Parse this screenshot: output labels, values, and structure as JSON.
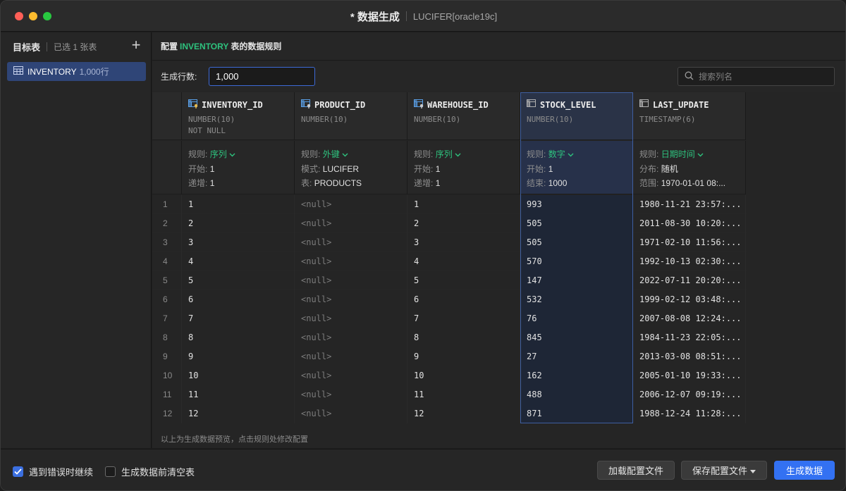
{
  "window": {
    "title": "* 数据生成",
    "connection": "LUCIFER[oracle19c]"
  },
  "sidebar": {
    "title": "目标表",
    "selected_count": "已选 1 张表",
    "add_label": "+",
    "items": [
      {
        "name": "INVENTORY",
        "rows": "1,000行"
      }
    ]
  },
  "config": {
    "prefix": "配置",
    "table": "INVENTORY",
    "suffix": "表的数据规则",
    "rows_label": "生成行数:",
    "rows_value": "1,000",
    "search_placeholder": "搜索列名"
  },
  "columns": [
    {
      "name": "INVENTORY_ID",
      "type": "NUMBER(10)",
      "constraint": "NOT NULL",
      "icon": "primary-key-column-icon",
      "rule": [
        {
          "k": "规则:",
          "v": "序列",
          "dropdown": true
        },
        {
          "k": "开始:",
          "v": "1"
        },
        {
          "k": "递增:",
          "v": "1"
        }
      ]
    },
    {
      "name": "PRODUCT_ID",
      "type": "NUMBER(10)",
      "constraint": "",
      "icon": "foreign-key-column-icon",
      "rule": [
        {
          "k": "规则:",
          "v": "外键",
          "dropdown": true
        },
        {
          "k": "模式:",
          "v": "LUCIFER"
        },
        {
          "k": "表:",
          "v": "PRODUCTS"
        }
      ]
    },
    {
      "name": "WAREHOUSE_ID",
      "type": "NUMBER(10)",
      "constraint": "",
      "icon": "foreign-key-column-icon",
      "rule": [
        {
          "k": "规则:",
          "v": "序列",
          "dropdown": true
        },
        {
          "k": "开始:",
          "v": "1"
        },
        {
          "k": "递增:",
          "v": "1"
        }
      ]
    },
    {
      "name": "STOCK_LEVEL",
      "type": "NUMBER(10)",
      "constraint": "",
      "icon": "column-icon",
      "rule": [
        {
          "k": "规则:",
          "v": "数字",
          "dropdown": true
        },
        {
          "k": "开始:",
          "v": "1"
        },
        {
          "k": "结束:",
          "v": "1000"
        }
      ]
    },
    {
      "name": "LAST_UPDATE",
      "type": "TIMESTAMP(6)",
      "constraint": "",
      "icon": "column-icon",
      "rule": [
        {
          "k": "规则:",
          "v": "日期时间",
          "dropdown": true
        },
        {
          "k": "分布:",
          "v": "随机"
        },
        {
          "k": "范围:",
          "v": "1970-01-01 08:..."
        }
      ]
    }
  ],
  "rows": [
    [
      "1",
      "1",
      "<null>",
      "1",
      "993",
      "1980-11-21 23:57:..."
    ],
    [
      "2",
      "2",
      "<null>",
      "2",
      "505",
      "2011-08-30 10:20:..."
    ],
    [
      "3",
      "3",
      "<null>",
      "3",
      "505",
      "1971-02-10 11:56:..."
    ],
    [
      "4",
      "4",
      "<null>",
      "4",
      "570",
      "1992-10-13 02:30:..."
    ],
    [
      "5",
      "5",
      "<null>",
      "5",
      "147",
      "2022-07-11 20:20:..."
    ],
    [
      "6",
      "6",
      "<null>",
      "6",
      "532",
      "1999-02-12 03:48:..."
    ],
    [
      "7",
      "7",
      "<null>",
      "7",
      "76",
      "2007-08-08 12:24:..."
    ],
    [
      "8",
      "8",
      "<null>",
      "8",
      "845",
      "1984-11-23 22:05:..."
    ],
    [
      "9",
      "9",
      "<null>",
      "9",
      "27",
      "2013-03-08 08:51:..."
    ],
    [
      "10",
      "10",
      "<null>",
      "10",
      "162",
      "2005-01-10 19:33:..."
    ],
    [
      "11",
      "11",
      "<null>",
      "11",
      "488",
      "2006-12-07 09:19:..."
    ],
    [
      "12",
      "12",
      "<null>",
      "12",
      "871",
      "1988-12-24 11:28:..."
    ]
  ],
  "hint": "以上为生成数据预览，点击规则处修改配置",
  "footer": {
    "continue_on_error": {
      "label": "遇到错误时继续",
      "checked": true
    },
    "truncate_before": {
      "label": "生成数据前清空表",
      "checked": false
    },
    "load_config": "加载配置文件",
    "save_config": "保存配置文件",
    "generate": "生成数据"
  },
  "colors": {
    "accent_green": "#2ec27e",
    "primary_blue": "#3371f2",
    "selected_item": "#2f4577"
  }
}
